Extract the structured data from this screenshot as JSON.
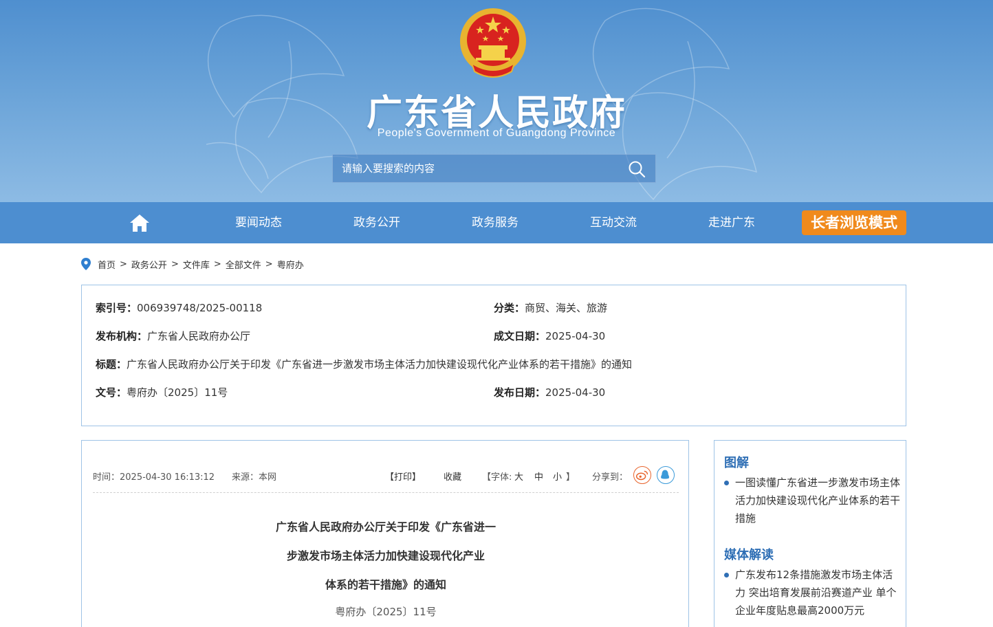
{
  "header": {
    "site_title": "广东省人民政府",
    "site_subtitle": "People's Government of Guangdong Province",
    "search_placeholder": "请输入要搜索的内容"
  },
  "nav": {
    "items": [
      {
        "label": "要闻动态"
      },
      {
        "label": "政务公开"
      },
      {
        "label": "政务服务"
      },
      {
        "label": "互动交流"
      },
      {
        "label": "走进广东"
      }
    ],
    "elder_mode": "长者浏览模式",
    "home_icon": "home-icon"
  },
  "breadcrumb": {
    "items": [
      "首页",
      "政务公开",
      "文件库",
      "全部文件",
      "粤府办"
    ],
    "separator": ">"
  },
  "info": {
    "index_label": "索引号：",
    "index_value": "006939748/2025-00118",
    "category_label": "分类：",
    "category_value": "商贸、海关、旅游",
    "publisher_label": "发布机构：",
    "publisher_value": "广东省人民政府办公厅",
    "created_label": "成文日期：",
    "created_value": "2025-04-30",
    "title_label": "标题：",
    "title_value": "广东省人民政府办公厅关于印发《广东省进一步激发市场主体活力加快建设现代化产业体系的若干措施》的通知",
    "docno_label": "文号：",
    "docno_value": "粤府办〔2025〕11号",
    "published_label": "发布日期：",
    "published_value": "2025-04-30"
  },
  "article": {
    "time": "时间：2025-04-30 16:13:12",
    "source": "来源：本网",
    "print": "【打印】",
    "favorite": "收藏",
    "font_prefix": "【字体:",
    "font_large": "大",
    "font_medium": "中",
    "font_small": "小",
    "font_suffix": "】",
    "share": "分享到：",
    "title_lines": [
      "广东省人民政府办公厅关于印发《广东省进一",
      "步激发市场主体活力加快建设现代化产业",
      "体系的若干措施》的通知"
    ],
    "doc_no": "粤府办〔2025〕11号"
  },
  "sidebar": {
    "section1_title": "图解",
    "section1_item": "一图读懂广东省进一步激发市场主体活力加快建设现代化产业体系的若干措施",
    "section2_title": "媒体解读",
    "section2_item": "广东发布12条措施激发市场主体活力 突出培育发展前沿赛道产业 单个企业年度贴息最高2000万元"
  },
  "colors": {
    "nav_bg": "#4d8ed0",
    "elder_btn": "#f08a1c",
    "border": "#9ec3e6",
    "accent": "#2f6fb5",
    "weibo": "#e8642c",
    "qq": "#3a9ad9"
  }
}
